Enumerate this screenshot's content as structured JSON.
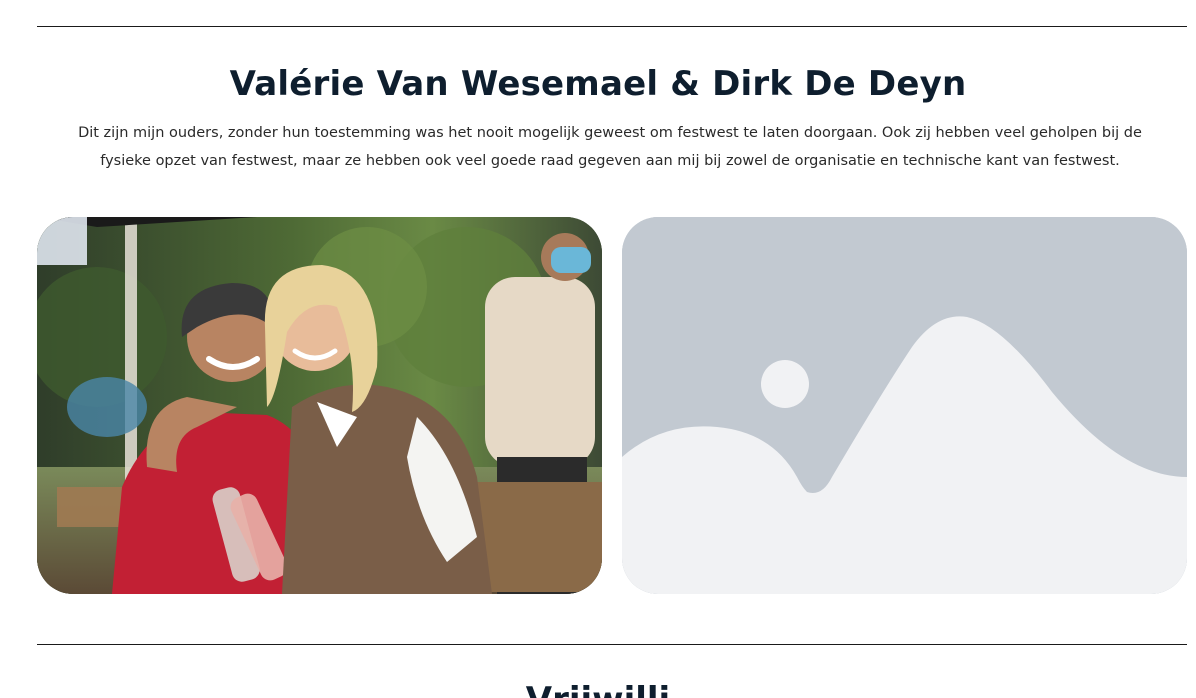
{
  "section": {
    "title": "Valérie Van Wesemael & Dirk De Deyn",
    "description": "Dit zijn mijn ouders, zonder hun toestemming was het nooit mogelijk geweest om festwest te laten doorgaan. Ook zij hebben veel geholpen bij de fysieke opzet van festwest, maar ze hebben ook veel goede raad gegeven aan mij bij zowel de organisatie en technische kant van festwest."
  },
  "images": {
    "photo_icon": "photo-icon",
    "placeholder_icon": "image-placeholder-icon"
  },
  "next_section": {
    "title": "Vrijwilli"
  },
  "colors": {
    "heading": "#0e1e2e",
    "placeholder_bg": "#c2c9d1",
    "placeholder_fg": "#f1f2f4"
  }
}
